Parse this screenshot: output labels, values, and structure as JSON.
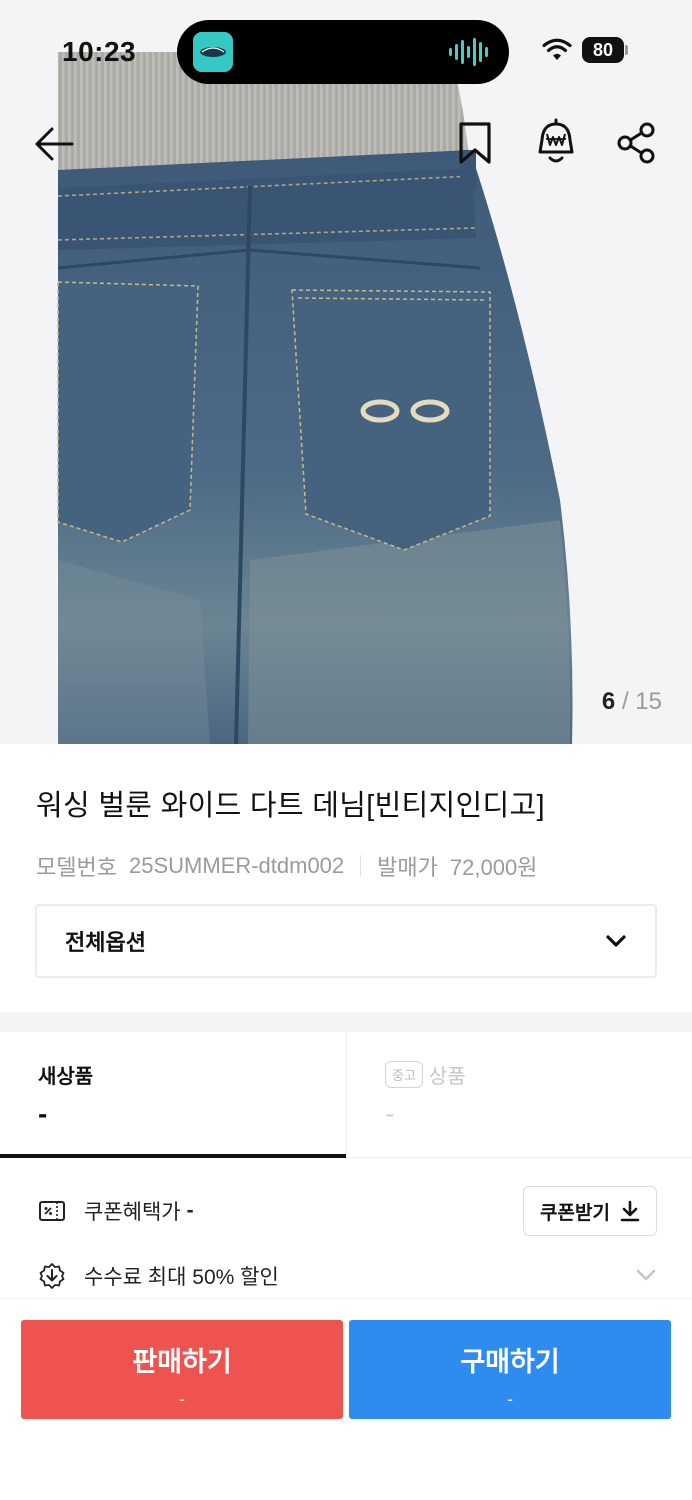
{
  "status_bar": {
    "time": "10:23",
    "battery": "80"
  },
  "gallery": {
    "current": "6",
    "separator": "/",
    "total": "15"
  },
  "product": {
    "title": "워싱 벌룬 와이드 다트 데님[빈티지인디고]",
    "model_label": "모델번호",
    "model_value": "25SUMMER-dtdm002",
    "release_label": "발매가",
    "release_value": "72,000원"
  },
  "option_select": {
    "label": "전체옵션"
  },
  "tabs": {
    "new": {
      "label": "새상품",
      "price": "-"
    },
    "used": {
      "badge": "중고",
      "label": "상품",
      "price": "-"
    }
  },
  "benefits": {
    "coupon_label": "쿠폰혜택가",
    "coupon_value": "-",
    "coupon_button": "쿠폰받기",
    "fee_label": "수수료 최대 50% 할인"
  },
  "actions": {
    "sell_label": "판매하기",
    "sell_price": "-",
    "buy_label": "구매하기",
    "buy_price": "-"
  },
  "colors": {
    "sell": "#ef5350",
    "buy": "#2e8cf0",
    "text": "#111111",
    "muted": "#9b9b9b"
  }
}
